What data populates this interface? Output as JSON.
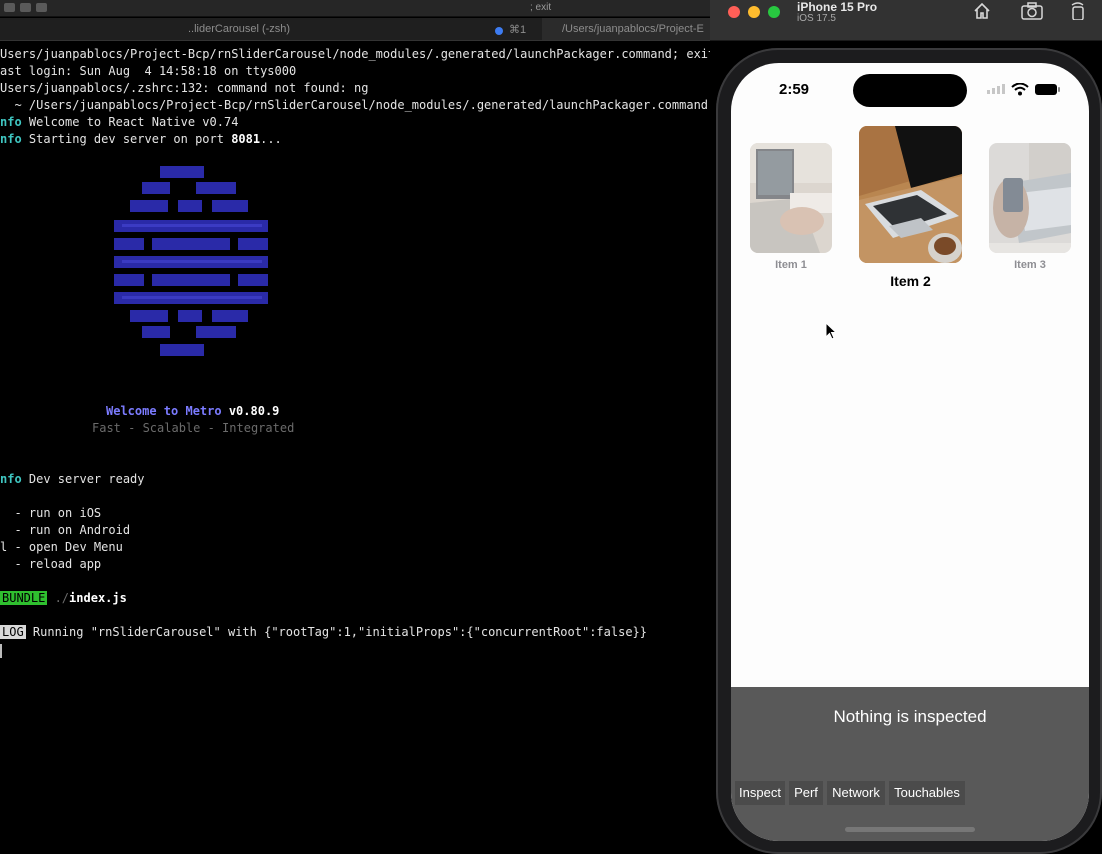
{
  "terminal": {
    "tab_title_left": "..liderCarousel (-zsh)",
    "tab_title_right": "/Users/juanpablocs/Project-E",
    "tab_shortcut": "⌘1",
    "top_title": "; exit",
    "lines": [
      "Users/juanpablocs/Project-Bcp/rnSliderCarousel/node_modules/.generated/launchPackager.command; exit",
      "ast login: Sun Aug  4 14:58:18 on ttys000",
      "Users/juanpablocs/.zshrc:132: command not found: ng",
      "  ~ /Users/juanpablocs/Project-Bcp/rnSliderCarousel/node_modules/.generated/launchPackager.command; exit"
    ],
    "info_welcome": {
      "tag": "nfo",
      "text": " Welcome to React Native v0.74"
    },
    "info_starting": {
      "tag": "nfo",
      "text": " Starting dev server on port ",
      "port": "8081",
      "suffix": "..."
    },
    "welcome_metro": "Welcome to Metro",
    "metro_version": " v0.80.9",
    "metro_tagline": "Fast - Scalable - Integrated",
    "info_ready": {
      "tag": "nfo",
      "text": " Dev server ready"
    },
    "menu": [
      "  - run on iOS",
      "  - run on Android",
      "l - open Dev Menu",
      "  - reload app"
    ],
    "bundle_badge": "BUNDLE",
    "bundle_path_dim": " ./",
    "bundle_file": "index.js",
    "log_badge": "LOG",
    "log_text": " Running \"rnSliderCarousel\" with {\"rootTag\":1,\"initialProps\":{\"concurrentRoot\":false}}"
  },
  "simulator": {
    "device_name": "iPhone 15 Pro",
    "os_version": "iOS 17.5",
    "status_time": "2:59",
    "carousel": [
      {
        "label": "Item 1",
        "selected": false
      },
      {
        "label": "Item 2",
        "selected": true
      },
      {
        "label": "Item 3",
        "selected": false
      }
    ],
    "inspector": {
      "message": "Nothing is inspected",
      "buttons": [
        "Inspect",
        "Perf",
        "Network",
        "Touchables"
      ]
    }
  },
  "colors": {
    "info": "#3fc6c1",
    "bundle_badge": "#2fbf2f",
    "metro_logo": "#2a2aa8",
    "inspector_bg": "#595959",
    "traffic_red": "#ff5f57",
    "traffic_yellow": "#febc2e",
    "traffic_green": "#28c840"
  }
}
